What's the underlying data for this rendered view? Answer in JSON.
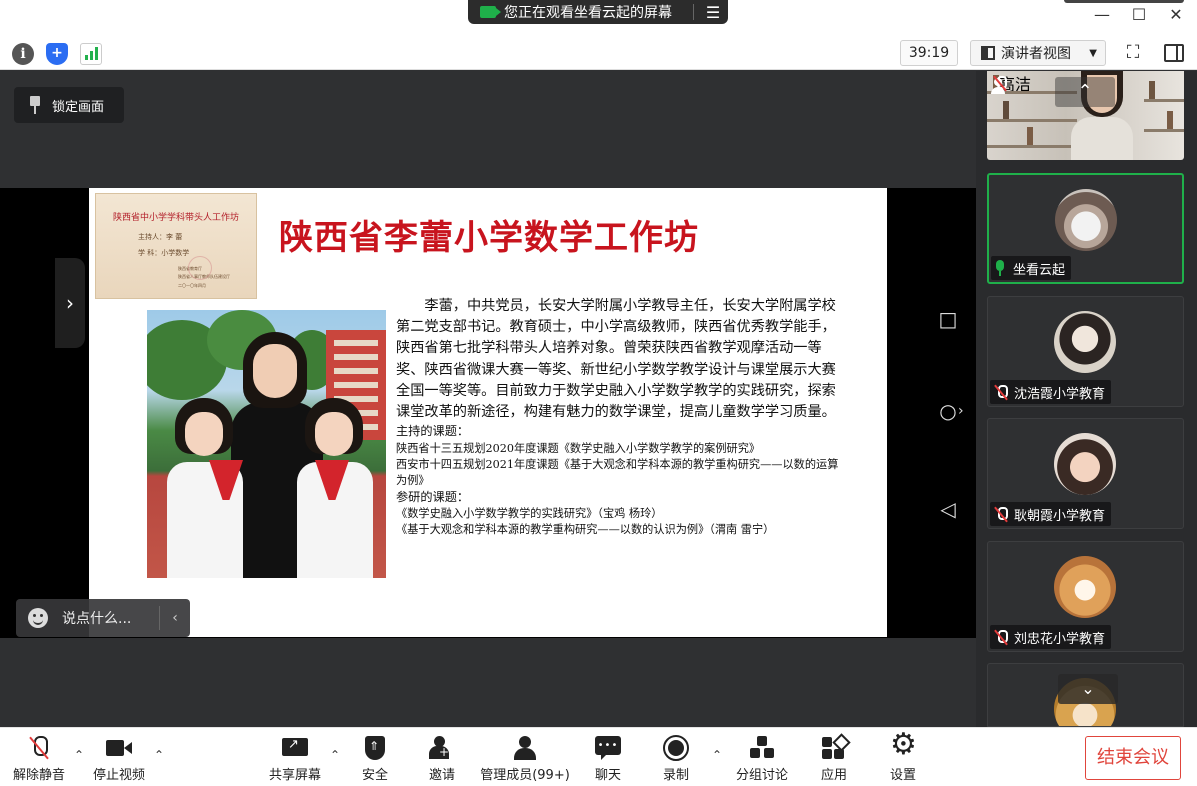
{
  "titlebar": {
    "share_banner": "您正在观看坐看云起的屏幕",
    "menu_glyph": "☰",
    "minimize_glyph": "—",
    "maximize_glyph": "☐",
    "close_glyph": "✕"
  },
  "toolbar": {
    "info_glyph": "i",
    "shield_glyph": "+",
    "timer": "39:19",
    "view_mode": "演讲者视图",
    "view_caret": "▼",
    "fullscreen_glyph": "⛶"
  },
  "main": {
    "lock_label": "锁定画面",
    "left_arrow": "›",
    "nav_square": "□",
    "nav_circle": "○",
    "nav_back": "◁",
    "nav_chevron": "›",
    "chat_placeholder": "说点什么...",
    "chat_collapse": "‹"
  },
  "slide": {
    "title": "陕西省李蕾小学数学工作坊",
    "certificate": {
      "title": "陕西省中小学学科带头人工作坊",
      "host": "主持人：李  蕾",
      "subject": "学    科：小学数学",
      "issuer_1": "陕西省教育厅",
      "issuer_2": "陕西省人事厅教师队伍建设厅",
      "date": "二〇一〇年四月"
    },
    "bio": "李蕾，中共党员，长安大学附属小学教导主任，长安大学附属学校第二党支部书记。教育硕士，中小学高级教师，陕西省优秀教学能手，陕西省第七批学科带头人培养对象。曾荣获陕西省教学观摩活动一等奖、陕西省微课大赛一等奖、新世纪小学数学教学设计与课堂展示大赛全国一等奖等。目前致力于数学史融入小学数学教学的实践研究，探索课堂改革的新途径，构建有魅力的数学课堂，提高儿童数学学习质量。",
    "host_topics_heading": "主持的课题：",
    "host_topics": [
      "陕西省十三五规划2020年度课题《数学史融入小学数学教学的案例研究》",
      "西安市十四五规划2021年度课题《基于大观念和学科本源的教学重构研究——以数的运算为例》"
    ],
    "research_topics_heading": "参研的课题：",
    "research_topics": [
      "《数学史融入小学数学教学的实践研究》（宝鸡  杨玲）",
      "《基于大观念和学科本源的教学重构研究——以数的认识为例》（渭南  雷宁）"
    ]
  },
  "participants": {
    "scroll_up": "⌃",
    "scroll_down": "⌄",
    "items": [
      {
        "name": "高洁",
        "role": "host",
        "muted": true
      },
      {
        "name": "坐看云起",
        "role": "sharer",
        "muted": false
      },
      {
        "name": "沈浩霞小学教育",
        "muted": true
      },
      {
        "name": "耿朝霞小学教育",
        "muted": true
      },
      {
        "name": "刘忠花小学教育",
        "muted": true
      }
    ]
  },
  "controls": {
    "caret": "⌃",
    "unmute": "解除静音",
    "stop_video": "停止视频",
    "share_screen": "共享屏幕",
    "security": "安全",
    "invite": "邀请",
    "manage_members": "管理成员(99+)",
    "chat": "聊天",
    "record": "录制",
    "breakout": "分组讨论",
    "apps": "应用",
    "settings": "设置",
    "end_meeting": "结束会议"
  },
  "colors": {
    "accent_green": "#1fb04a",
    "end_red": "#e0453c",
    "slide_title_red": "#c8141e"
  }
}
